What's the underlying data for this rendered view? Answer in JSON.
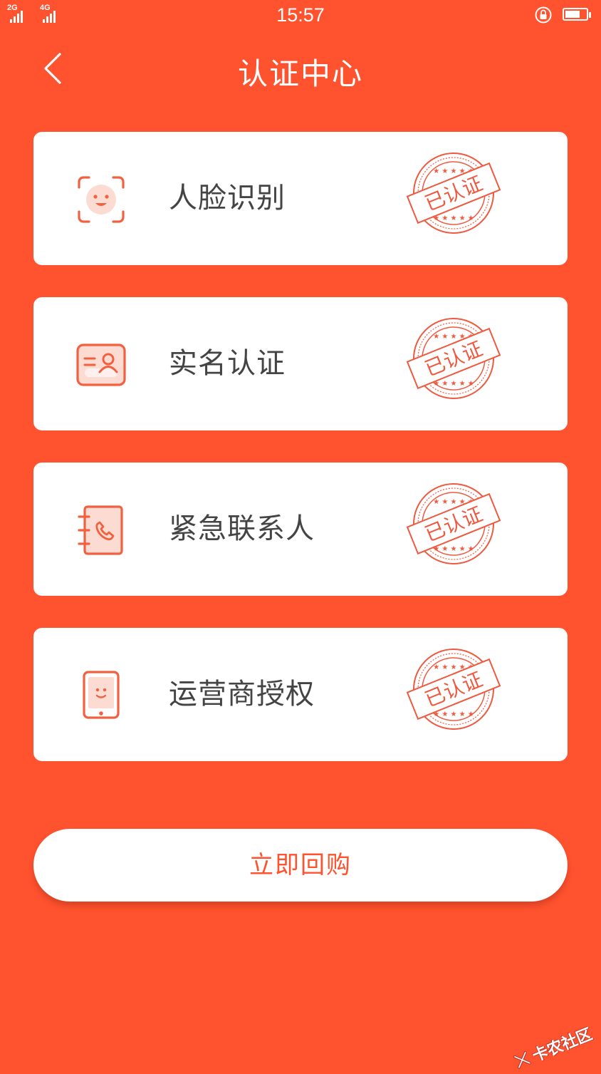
{
  "status_bar": {
    "network_1": "2G",
    "network_2": "4G",
    "time": "15:57"
  },
  "header": {
    "title": "认证中心"
  },
  "cards": [
    {
      "label": "人脸识别",
      "icon": "face-scan-icon",
      "stamp": "已认证"
    },
    {
      "label": "实名认证",
      "icon": "id-card-icon",
      "stamp": "已认证"
    },
    {
      "label": "紧急联系人",
      "icon": "contact-book-icon",
      "stamp": "已认证"
    },
    {
      "label": "运营商授权",
      "icon": "phone-icon",
      "stamp": "已认证"
    }
  ],
  "action_button": {
    "label": "立即回购"
  },
  "watermark": {
    "text": "卡农社区"
  },
  "colors": {
    "background": "#FF522F",
    "card": "#FFFFFF",
    "icon_accent": "#F2613F",
    "stamp": "#EE5A40"
  }
}
